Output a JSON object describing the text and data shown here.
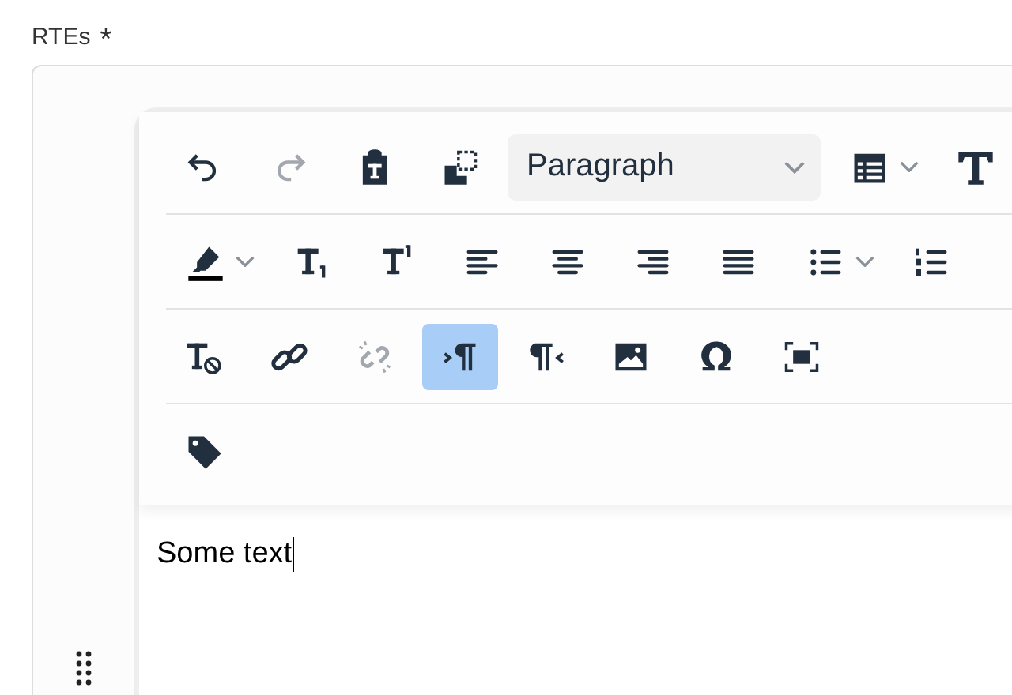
{
  "field": {
    "label": "RTEs",
    "required_mark": "*"
  },
  "toolbar": [
    {
      "buttons": [
        {
          "kind": "undo",
          "disabled": false,
          "selected": false,
          "menu": false
        },
        {
          "kind": "redo",
          "disabled": true,
          "selected": false,
          "menu": false
        },
        {
          "kind": "pastetext",
          "disabled": false,
          "selected": false,
          "menu": false
        },
        {
          "kind": "copyformat",
          "disabled": false,
          "selected": false,
          "menu": false
        },
        {
          "kind": "select",
          "value": "Paragraph",
          "menu": true
        },
        {
          "kind": "table",
          "disabled": false,
          "selected": false,
          "menu": true
        },
        {
          "kind": "bold",
          "disabled": false,
          "selected": false,
          "menu": false
        }
      ]
    },
    {
      "buttons": [
        {
          "kind": "highlight",
          "disabled": false,
          "selected": false,
          "menu": true
        },
        {
          "kind": "subscript",
          "disabled": false,
          "selected": false,
          "menu": false
        },
        {
          "kind": "superscript",
          "disabled": false,
          "selected": false,
          "menu": false
        },
        {
          "kind": "alignleft",
          "disabled": false,
          "selected": false,
          "menu": false
        },
        {
          "kind": "aligncenter",
          "disabled": false,
          "selected": false,
          "menu": false
        },
        {
          "kind": "alignright",
          "disabled": false,
          "selected": false,
          "menu": false
        },
        {
          "kind": "justify",
          "disabled": false,
          "selected": false,
          "menu": false
        },
        {
          "kind": "bullets",
          "disabled": false,
          "selected": false,
          "menu": true
        },
        {
          "kind": "numbers",
          "disabled": false,
          "selected": false,
          "menu": false
        }
      ]
    },
    {
      "buttons": [
        {
          "kind": "clearformat",
          "disabled": false,
          "selected": false,
          "menu": false
        },
        {
          "kind": "link",
          "disabled": false,
          "selected": false,
          "menu": false
        },
        {
          "kind": "unlink",
          "disabled": true,
          "selected": false,
          "menu": false
        },
        {
          "kind": "ltr",
          "disabled": false,
          "selected": true,
          "menu": false
        },
        {
          "kind": "rtl",
          "disabled": false,
          "selected": false,
          "menu": false
        },
        {
          "kind": "image",
          "disabled": false,
          "selected": false,
          "menu": false
        },
        {
          "kind": "charmap",
          "disabled": false,
          "selected": false,
          "menu": false
        },
        {
          "kind": "fullscreen",
          "disabled": false,
          "selected": false,
          "menu": false
        }
      ]
    },
    {
      "buttons": [
        {
          "kind": "tag",
          "disabled": false,
          "selected": false,
          "menu": false
        }
      ]
    }
  ],
  "content": "Some text"
}
